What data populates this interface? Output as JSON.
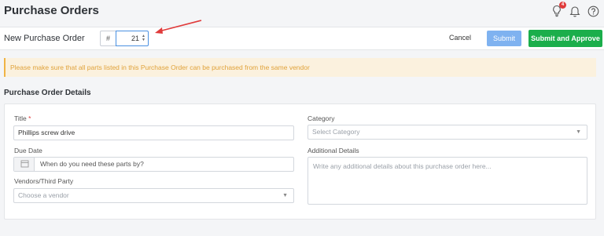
{
  "page": {
    "title": "Purchase Orders"
  },
  "top_icons": {
    "lightbulb": "lightbulb-icon",
    "badge_count": "4",
    "bell": "bell-icon",
    "help": "help-icon"
  },
  "header": {
    "title": "New Purchase Order",
    "number_prefix": "#",
    "number_value": "21",
    "cancel_label": "Cancel",
    "submit_label": "Submit",
    "approve_label": "Submit and Approve"
  },
  "alert": {
    "text": "Please make sure that all parts listed in this Purchase Order can be purchased from the same vendor"
  },
  "section": {
    "title": "Purchase Order Details"
  },
  "form": {
    "title_label": "Title",
    "required_mark": "*",
    "title_value": "Phillips screw drive",
    "category_label": "Category",
    "category_placeholder": "Select Category",
    "due_date_label": "Due Date",
    "due_date_placeholder": "When do you need these parts by?",
    "additional_label": "Additional Details",
    "additional_placeholder": "Write any additional details about this purchase order here...",
    "vendor_label": "Vendors/Third Party",
    "vendor_placeholder": "Choose a vendor"
  },
  "colors": {
    "accent": "#4a90e2",
    "approve": "#1bae4b",
    "submit": "#7fb2f0",
    "warning": "#e0a23a",
    "annotation_arrow": "#e03b3b"
  }
}
